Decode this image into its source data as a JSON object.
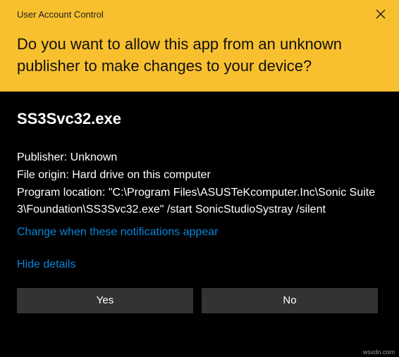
{
  "titlebar": {
    "title": "User Account Control"
  },
  "header": {
    "question": "Do you want to allow this app from an unknown publisher to make changes to your device?"
  },
  "body": {
    "app_name": "SS3Svc32.exe",
    "publisher_label": "Publisher: ",
    "publisher_value": "Unknown",
    "origin_label": "File origin: ",
    "origin_value": "Hard drive on this computer",
    "location_label": "Program location: ",
    "location_value": "\"C:\\Program Files\\ASUSTeKcomputer.Inc\\Sonic Suite 3\\Foundation\\SS3Svc32.exe\" /start SonicStudioSystray /silent",
    "change_link": "Change when these notifications appear",
    "hide_link": "Hide details"
  },
  "buttons": {
    "yes": "Yes",
    "no": "No"
  },
  "watermark": "wsxdn.com"
}
